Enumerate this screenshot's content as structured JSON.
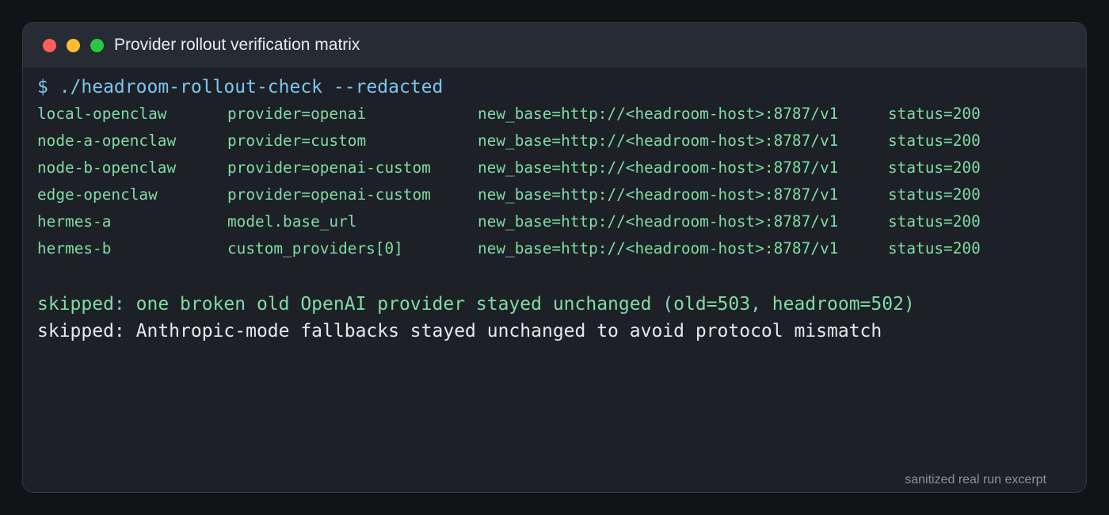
{
  "window": {
    "title": "Provider rollout verification matrix",
    "footer": "sanitized real run excerpt"
  },
  "terminal": {
    "command": "$ ./headroom-rollout-check --redacted",
    "rows": [
      {
        "name": "local-openclaw",
        "provider": "provider=openai",
        "base": "new_base=http://<headroom-host>:8787/v1",
        "status": "status=200"
      },
      {
        "name": "node-a-openclaw",
        "provider": "provider=custom",
        "base": "new_base=http://<headroom-host>:8787/v1",
        "status": "status=200"
      },
      {
        "name": "node-b-openclaw",
        "provider": "provider=openai-custom",
        "base": "new_base=http://<headroom-host>:8787/v1",
        "status": "status=200"
      },
      {
        "name": "edge-openclaw",
        "provider": "provider=openai-custom",
        "base": "new_base=http://<headroom-host>:8787/v1",
        "status": "status=200"
      },
      {
        "name": "hermes-a",
        "provider": "model.base_url",
        "base": "new_base=http://<headroom-host>:8787/v1",
        "status": "status=200"
      },
      {
        "name": "hermes-b",
        "provider": "custom_providers[0]",
        "base": "new_base=http://<headroom-host>:8787/v1",
        "status": "status=200"
      }
    ],
    "skipped": [
      "skipped: one broken old OpenAI provider stayed unchanged (old=503, headroom=502)",
      "skipped: Anthropic-mode fallbacks stayed unchanged to avoid protocol mismatch"
    ]
  },
  "colors": {
    "command": "#7cc6f0",
    "output": "#7fdca2",
    "text": "#e6e8eb"
  }
}
